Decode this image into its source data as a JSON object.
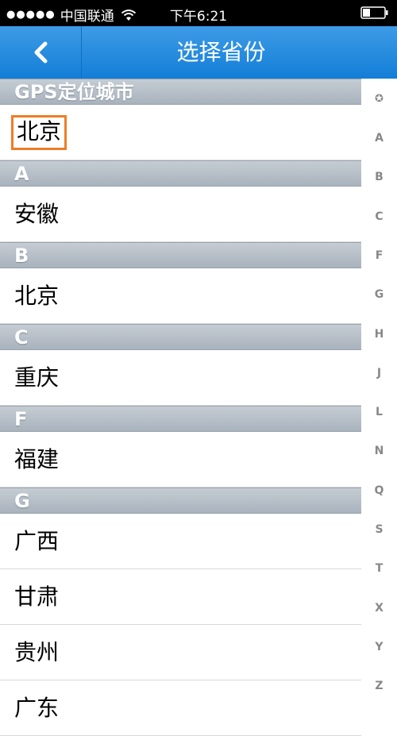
{
  "status_bar": {
    "signal": "●●●●●",
    "carrier": "中国联通",
    "time": "下午6:21"
  },
  "nav": {
    "back_icon": "chevron-left-icon",
    "title": "选择省份"
  },
  "gps": {
    "header": "GPS定位城市",
    "city": "北京",
    "highlight_color": "#ee7d27"
  },
  "sections": [
    {
      "letter": "A",
      "items": [
        "安徽"
      ]
    },
    {
      "letter": "B",
      "items": [
        "北京"
      ]
    },
    {
      "letter": "C",
      "items": [
        "重庆"
      ]
    },
    {
      "letter": "F",
      "items": [
        "福建"
      ]
    },
    {
      "letter": "G",
      "items": [
        "广西",
        "甘肃",
        "贵州",
        "广东"
      ]
    }
  ],
  "index_bar": {
    "star": "✪",
    "letters": [
      "A",
      "B",
      "C",
      "F",
      "G",
      "H",
      "J",
      "L",
      "N",
      "Q",
      "S",
      "T",
      "X",
      "Y",
      "Z"
    ]
  },
  "colors": {
    "nav_blue": "#1a84db",
    "section_gray": "#b4bdc6"
  }
}
